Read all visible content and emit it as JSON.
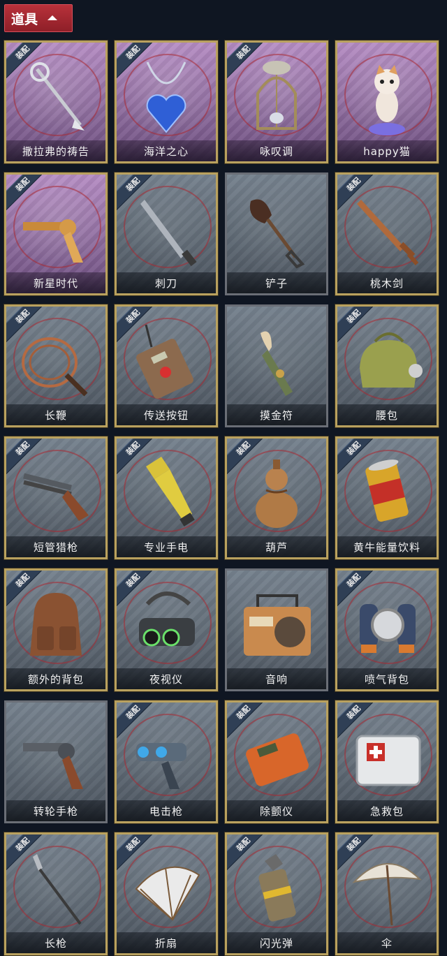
{
  "header": {
    "title": "道具"
  },
  "badge_text": "装配",
  "items": [
    {
      "name": "撒拉弗的祷告",
      "equipped": true,
      "rarity": "purple",
      "icon": "scepter-icon"
    },
    {
      "name": "海洋之心",
      "equipped": true,
      "rarity": "purple",
      "icon": "heart-necklace-icon"
    },
    {
      "name": "咏叹调",
      "equipped": true,
      "rarity": "purple",
      "icon": "birdcage-icon"
    },
    {
      "name": "happy猫",
      "equipped": false,
      "rarity": "purple",
      "icon": "cat-figurine-icon"
    },
    {
      "name": "新星时代",
      "equipped": true,
      "rarity": "purple",
      "icon": "revolver-gold-icon"
    },
    {
      "name": "刺刀",
      "equipped": true,
      "rarity": "gray",
      "icon": "bayonet-icon"
    },
    {
      "name": "铲子",
      "equipped": false,
      "rarity": "gray",
      "icon": "shovel-icon"
    },
    {
      "name": "桃木剑",
      "equipped": true,
      "rarity": "gray",
      "icon": "wooden-sword-icon"
    },
    {
      "name": "长鞭",
      "equipped": true,
      "rarity": "gray",
      "icon": "whip-icon"
    },
    {
      "name": "传送按钮",
      "equipped": true,
      "rarity": "gray",
      "icon": "teleport-remote-icon"
    },
    {
      "name": "摸金符",
      "equipped": false,
      "rarity": "gray",
      "icon": "amulet-claw-icon"
    },
    {
      "name": "腰包",
      "equipped": true,
      "rarity": "gray",
      "icon": "waist-bag-icon"
    },
    {
      "name": "短管猎枪",
      "equipped": true,
      "rarity": "gray",
      "icon": "shotgun-icon"
    },
    {
      "name": "专业手电",
      "equipped": true,
      "rarity": "gray",
      "icon": "flashlight-icon"
    },
    {
      "name": "葫芦",
      "equipped": true,
      "rarity": "gray",
      "icon": "gourd-icon"
    },
    {
      "name": "黄牛能量饮料",
      "equipped": true,
      "rarity": "gray",
      "icon": "energy-drink-icon"
    },
    {
      "name": "额外的背包",
      "equipped": true,
      "rarity": "gray",
      "icon": "backpack-icon"
    },
    {
      "name": "夜视仪",
      "equipped": true,
      "rarity": "gray",
      "icon": "night-vision-icon"
    },
    {
      "name": "音响",
      "equipped": false,
      "rarity": "gray",
      "icon": "radio-speaker-icon"
    },
    {
      "name": "喷气背包",
      "equipped": true,
      "rarity": "gray",
      "icon": "jetpack-icon"
    },
    {
      "name": "转轮手枪",
      "equipped": false,
      "rarity": "gray",
      "icon": "revolver-icon"
    },
    {
      "name": "电击枪",
      "equipped": true,
      "rarity": "gray",
      "icon": "shock-gun-icon"
    },
    {
      "name": "除颤仪",
      "equipped": true,
      "rarity": "gray",
      "icon": "defibrillator-icon"
    },
    {
      "name": "急救包",
      "equipped": true,
      "rarity": "gray",
      "icon": "first-aid-kit-icon"
    },
    {
      "name": "长枪",
      "equipped": true,
      "rarity": "gray",
      "icon": "spear-icon"
    },
    {
      "name": "折扇",
      "equipped": true,
      "rarity": "gray",
      "icon": "folding-fan-icon"
    },
    {
      "name": "闪光弹",
      "equipped": true,
      "rarity": "gray",
      "icon": "flashbang-icon"
    },
    {
      "name": "伞",
      "equipped": true,
      "rarity": "gray",
      "icon": "umbrella-icon"
    }
  ]
}
